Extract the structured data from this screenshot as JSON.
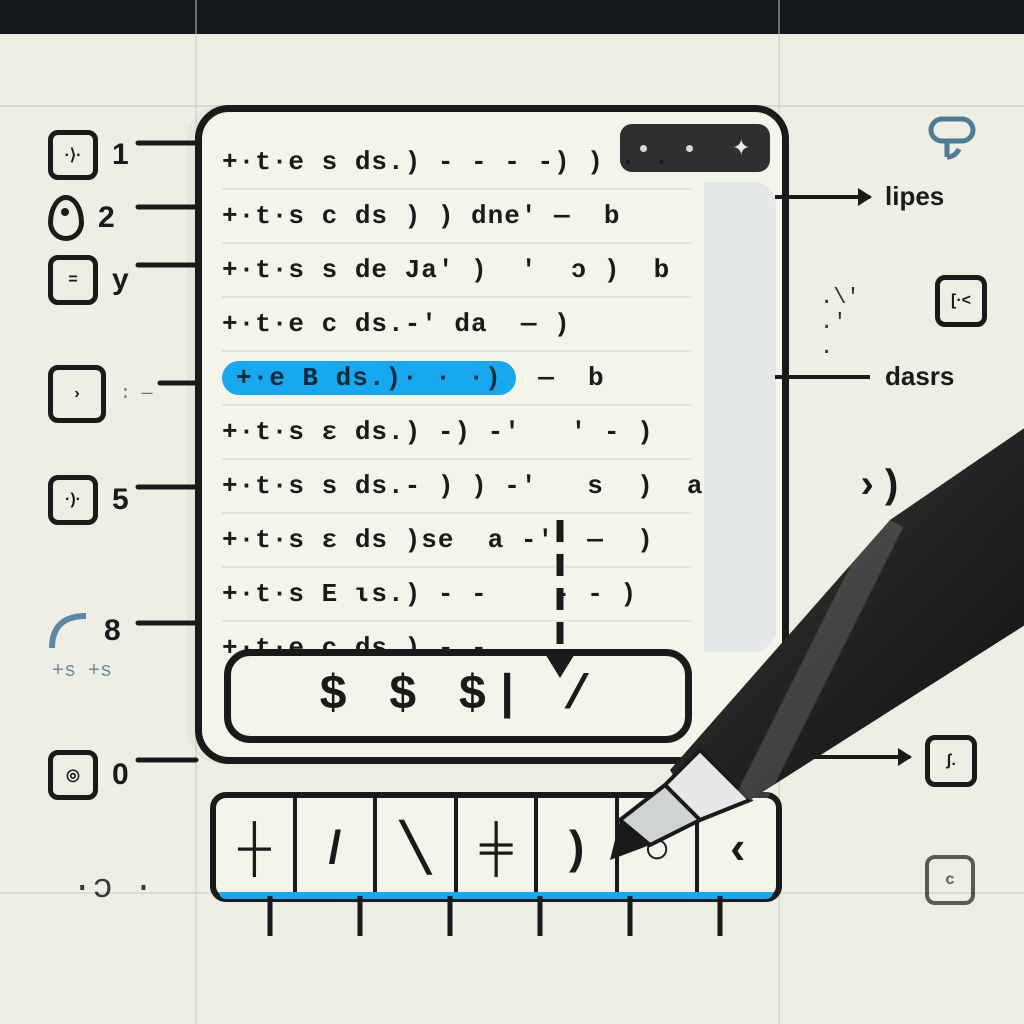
{
  "titlebar": {
    "spark": "✦"
  },
  "code_lines": [
    "+·t·e s ds.) - - - -) ) · ·",
    "+·t·s c ds ) ) dne' —  b",
    "+·t·s s de Ja' )  '  ɔ )  b",
    "+·t·e c ds.-' da  — )",
    "+·e B ds.)· · ·)",
    "+·t·s ɛ ds.) -) -'   ' - )",
    "+·t·s s ds.- ) ) -'   s  )  a",
    "+·t·s ɛ ds )se  a -'  —  )",
    "+·t·s E ɩs.) - -    - - )",
    "+·t·e c ds.) - -"
  ],
  "highlighted_fragment": "+·e B ds.)· · ·)",
  "line_tail_after_highlight": " —  b",
  "input_value": "$  $  $|  /",
  "gutter": [
    {
      "num": "1",
      "icon": "dot-box"
    },
    {
      "num": "2",
      "icon": "pin"
    },
    {
      "num": "y",
      "icon": "equals-box"
    },
    {
      "num": "",
      "icon": "chevron-box"
    },
    {
      "num": "5",
      "icon": "dot-paren-box"
    },
    {
      "num": "8",
      "icon": "arc"
    },
    {
      "num": "0",
      "icon": "target-box"
    }
  ],
  "right": {
    "label_top": "lipes",
    "label_mid": "dasrs",
    "dots": ".\\'  .' .",
    "bracket_box": "[·<",
    "chev": "›)",
    "j_box": "ʃ.",
    "c_box": "c"
  },
  "keys": [
    "┼",
    "/",
    "╲",
    "╪",
    ")",
    "○",
    "‹"
  ],
  "tiny_left_bottom": "·ɔ  ·",
  "tiny_grid_8": "+s\n+s"
}
